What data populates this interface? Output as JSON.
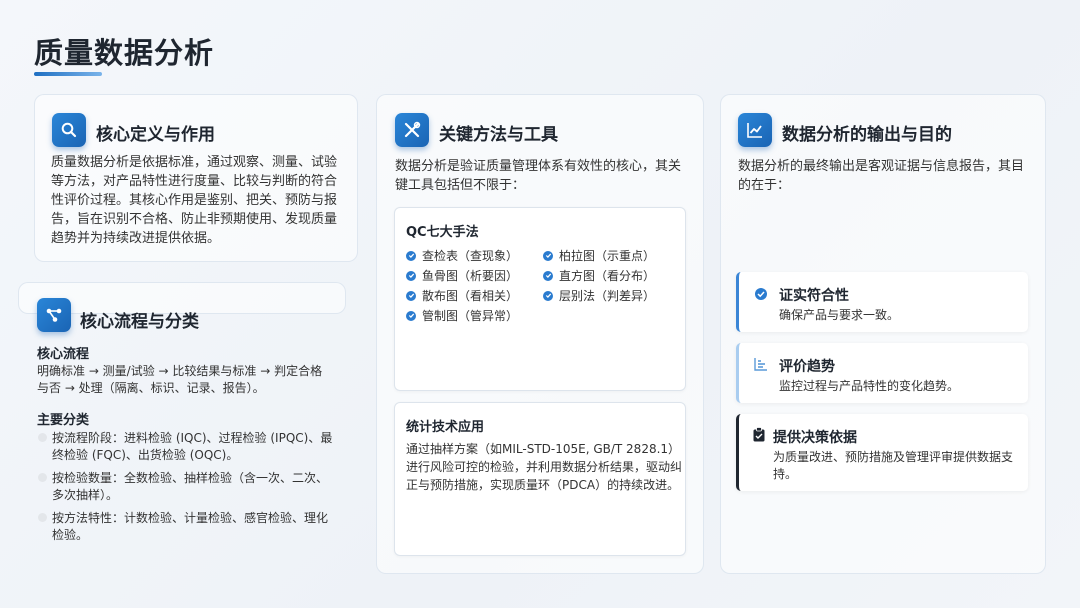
{
  "page": {
    "title": "质量数据分析"
  },
  "definition": {
    "heading": "核心定义与作用",
    "icon": "search-icon",
    "text": "质量数据分析是依据标准，通过观察、测量、试验等方法，对产品特性进行度量、比较与判断的符合性评价过程。其核心作用是鉴别、把关、预防与报告，旨在识别不合格、防止非预期使用、发现质量趋势并为持续改进提供依据。"
  },
  "process": {
    "heading": "核心流程与分类",
    "icon": "share-nodes-icon",
    "flow_title": "核心流程",
    "flow_text": "明确标准 → 测量/试验 → 比较结果与标准 → 判定合格与否 → 处理（隔离、标识、记录、报告）。",
    "class_title": "主要分类",
    "classes": [
      "按流程阶段：进料检验 (IQC)、过程检验 (IPQC)、最终检验 (FQC)、出货检验 (OQC)。",
      "按检验数量：全数检验、抽样检验（含一次、二次、多次抽样）。",
      "按方法特性：计数检验、计量检验、感官检验、理化检验。"
    ]
  },
  "methods": {
    "heading": "关键方法与工具",
    "icon": "wrench-screwdriver-icon",
    "intro": "数据分析是验证质量管理体系有效性的核心，其关键工具包括但不限于：",
    "qc": {
      "title": "QC七大手法",
      "tools": [
        "查检表（查现象）",
        "柏拉图（示重点）",
        "鱼骨图（析要因）",
        "直方图（看分布）",
        "散布图（看相关）",
        "层别法（判差异）",
        "管制图（管异常）"
      ]
    },
    "stats": {
      "title": "统计技术应用",
      "text": "通过抽样方案（如MIL-STD-105E, GB/T 2828.1）进行风险可控的检验，并利用数据分析结果，驱动纠正与预防措施，实现质量环（PDCA）的持续改进。"
    }
  },
  "output": {
    "heading": "数据分析的输出与目的",
    "icon": "line-chart-icon",
    "intro": "数据分析的最终输出是客观证据与信息报告，其目的在于：",
    "items": [
      {
        "title": "证实符合性",
        "desc": "确保产品与要求一致。",
        "icon": "check-badge-icon",
        "accent": "#3b86d6"
      },
      {
        "title": "评价趋势",
        "desc": "监控过程与产品特性的变化趋势。",
        "icon": "bar-chart-icon",
        "accent": "#a9cdf0"
      },
      {
        "title": "提供决策依据",
        "desc": "为质量改进、预防措施及管理评审提供数据支持。",
        "icon": "clipboard-check-icon",
        "accent": "#1f2630"
      }
    ]
  }
}
